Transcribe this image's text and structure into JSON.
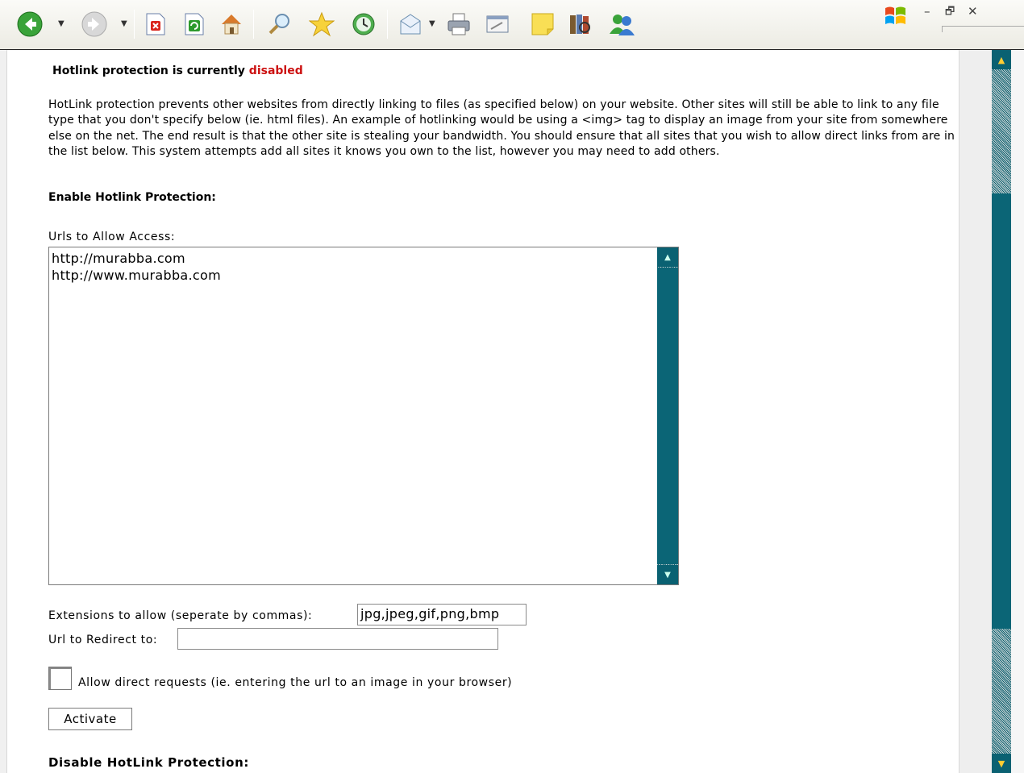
{
  "toolbar": {
    "icons": [
      "back-icon",
      "forward-icon",
      "stop-icon",
      "refresh-icon",
      "home-icon",
      "search-icon",
      "favorites-icon",
      "history-icon",
      "mail-icon",
      "print-icon",
      "edit-icon",
      "notes-icon",
      "research-icon",
      "messenger-icon"
    ]
  },
  "window": {
    "minimize": "–",
    "restore": "🗗",
    "close": "✕"
  },
  "page": {
    "status_prefix": "Hotlink protection is currently",
    "status_value": "disabled",
    "description": "HotLink protection prevents other websites from directly linking to files (as specified below) on your website. Other sites will still be able to link to any file type that you don't specify below (ie. html files). An example of hotlinking would be using a <img> tag to display an image from your site from somewhere else on the net. The end result is that the other site is stealing your bandwidth. You should ensure that all sites that you wish to allow direct links from are in the list below. This system attempts add all sites it knows you own to the list, however you may need to add others.",
    "enable_heading": "Enable Hotlink Protection:",
    "urls_label": "Urls to Allow Access:",
    "urls_value": "http://murabba.com\nhttp://www.murabba.com",
    "extensions_label": "Extensions to allow (seperate by commas):",
    "extensions_value": "jpg,jpeg,gif,png,bmp",
    "redirect_label": "Url to Redirect to:",
    "redirect_value": "",
    "direct_requests_label": "Allow direct requests (ie. entering the url to an image in your browser)",
    "direct_requests_checked": false,
    "activate_label": "Activate",
    "disable_heading": "Disable HotLink Protection:"
  },
  "colors": {
    "disabled": "#cc1111",
    "scrollbar": "#0b6576"
  }
}
